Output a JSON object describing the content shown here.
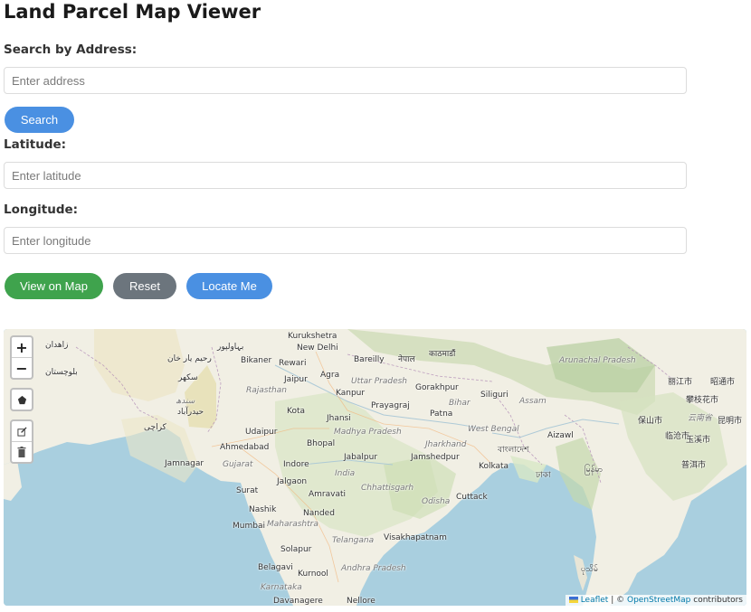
{
  "title": "Land Parcel Map Viewer",
  "search": {
    "label": "Search by Address:",
    "placeholder": "Enter address",
    "button": "Search"
  },
  "latitude": {
    "label": "Latitude:",
    "placeholder": "Enter latitude"
  },
  "longitude": {
    "label": "Longitude:",
    "placeholder": "Enter longitude"
  },
  "actions": {
    "view": "View on Map",
    "reset": "Reset",
    "locate": "Locate Me"
  },
  "colors": {
    "blue": "#4a90e2",
    "green": "#3fa34d",
    "gray": "#6c757d",
    "water": "#a9cfdf",
    "land": "#f1efe4"
  },
  "map": {
    "controls": {
      "zoom_in": "+",
      "zoom_out": "−",
      "draw_polygon_icon": "pentagon-icon",
      "edit_icon": "edit-icon",
      "delete_icon": "trash-icon"
    },
    "places": [
      "Kurukshetra",
      "New Delhi",
      "Bikaner",
      "Rewari",
      "Bareilly",
      "Agra",
      "Uttar Pradesh",
      "Jaipur",
      "Rajasthan",
      "Kanpur",
      "Prayagraj",
      "Gorakhpur",
      "Bihar",
      "Patna",
      "Siliguri",
      "Assam",
      "Kota",
      "Jhansi",
      "Madhya Pradesh",
      "Ahmedabad",
      "Bhopal",
      "Jharkhand",
      "West Bengal",
      "Udaipur",
      "Gujarat",
      "Indore",
      "Jabalpur",
      "Jamshedpur",
      "Kolkata",
      "India",
      "Aizawl",
      "Jamnagar",
      "Surat",
      "Jalgaon",
      "Chhattisgarh",
      "Amravati",
      "Cuttack",
      "Nashik",
      "Odisha",
      "Mumbai",
      "Nanded",
      "Maharashtra",
      "Telangana",
      "Visakhapatnam",
      "Solapur",
      "Belagavi",
      "Kurnool",
      "Andhra Pradesh",
      "Karnataka",
      "Davanagere",
      "Nellore",
      "Arunachal Pradesh",
      "नेपाल",
      "काठमाडौं",
      "বাংলাদেশ",
      "ঢাকা",
      "မြန်မာ",
      "ပုသိမ်",
      "丽江市",
      "攀枝花市",
      "昆明市",
      "保山市",
      "临沧市",
      "玉溪市",
      "普洱市",
      "云南省",
      "昭通市",
      "بلوچستان",
      "سکھر",
      "کراچی",
      "حیدرآباد",
      "سندھ",
      "بہاولپور",
      "رحيم يار خان",
      "زاهدان"
    ],
    "attribution": {
      "leaflet": "Leaflet",
      "separator": "| ©",
      "osm": "OpenStreetMap",
      "suffix": "contributors"
    }
  }
}
